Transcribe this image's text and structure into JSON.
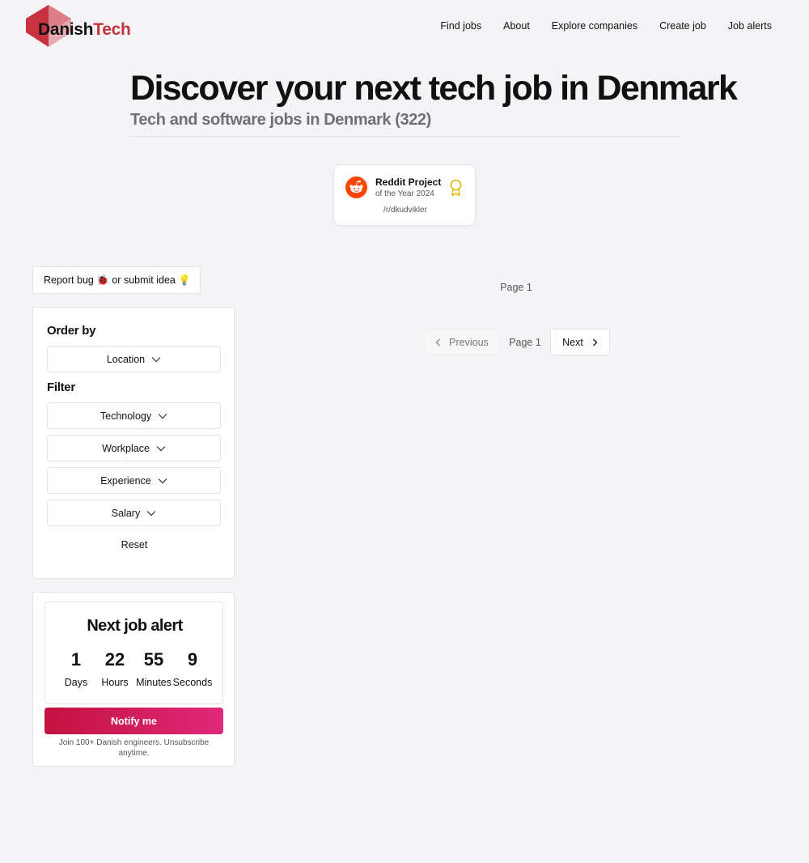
{
  "brand": {
    "part1": "Danish",
    "part2": "Tech",
    "accent": "#c8323f"
  },
  "nav": [
    {
      "label": "Find jobs"
    },
    {
      "label": "About"
    },
    {
      "label": "Explore companies"
    },
    {
      "label": "Create job"
    },
    {
      "label": "Job alerts"
    }
  ],
  "hero": {
    "title": "Discover your next tech job in Denmark",
    "subtitle": "Tech and software jobs in Denmark (322)"
  },
  "award": {
    "title": "Reddit Project",
    "subtitle": "of the Year 2024",
    "subreddit": "/r/dkudvikler",
    "icon": "reddit-icon"
  },
  "report": {
    "label": "Report bug 🐞 or submit idea 💡"
  },
  "filters": {
    "order_title": "Order by",
    "order_value": "Location",
    "filter_title": "Filter",
    "options": [
      "Technology",
      "Workplace",
      "Experience",
      "Salary"
    ],
    "reset_label": "Reset"
  },
  "job_alert": {
    "title": "Next job alert",
    "countdown": [
      {
        "value": "1",
        "unit": "Days"
      },
      {
        "value": "22",
        "unit": "Hours"
      },
      {
        "value": "55",
        "unit": "Minutes"
      },
      {
        "value": "9",
        "unit": "Seconds"
      }
    ],
    "button_label": "Notify me",
    "note": "Join 100+ Danish engineers. Unsubscribe anytime.",
    "button_gradient": [
      "#c2123f",
      "#e0297a"
    ]
  },
  "pagination": {
    "top_label": "Page 1",
    "prev_label": "Previous",
    "current_label": "Page 1",
    "next_label": "Next"
  }
}
